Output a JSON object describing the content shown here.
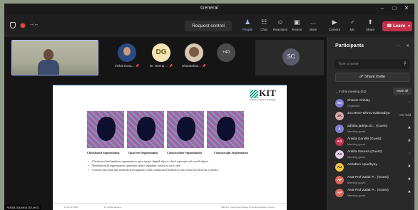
{
  "window": {
    "title": "General"
  },
  "toolbar": {
    "timer": "--:--",
    "request_control": "Request control",
    "items": [
      {
        "label": "People",
        "icon": "people-icon",
        "glyph": "♟"
      },
      {
        "label": "Chat",
        "icon": "chat-icon",
        "glyph": "☷"
      },
      {
        "label": "Reactions",
        "icon": "reactions-icon",
        "glyph": "☺"
      },
      {
        "label": "Rooms",
        "icon": "rooms-icon",
        "glyph": "▣"
      },
      {
        "label": "More",
        "icon": "more-icon",
        "glyph": "…"
      },
      {
        "label": "Camera",
        "icon": "camera-icon",
        "glyph": "▶"
      },
      {
        "label": "Mic",
        "icon": "mic-icon",
        "glyph": "♂"
      },
      {
        "label": "Share",
        "icon": "share-icon",
        "glyph": "⬆"
      }
    ],
    "leave": "Leave"
  },
  "stage": {
    "attendees": [
      {
        "name": "Vishal Nesa..."
      },
      {
        "name": "Dr. Neeraj ...",
        "initials": "DG"
      },
      {
        "name": "Dhanashas..."
      }
    ],
    "more_count": "+40",
    "sc_initials": "SC",
    "self_name": "Ankita Saxena (Guest)"
  },
  "slide": {
    "logo_text": "KIT",
    "logo_sub": "Karlsruhe Institute of Technology",
    "labels": [
      "Checkboard Segmentation",
      "Quad tree Segmentation",
      "Contrast filter Segmentation",
      "Contrast split Segmentation"
    ],
    "bullets": [
      "Chessboard and quadtree segmentation- give square shaped objects- don't represent real world objects",
      "Multithreshold segmentation- generates object segments- based on color only",
      "Contrast filter and split methods are brightness value complicated methods as the results are difficult to predict."
    ],
    "footer_left": "15  21.07.2022",
    "footer_mid": "Dr. Ankita Saxena",
    "footer_right": "IMK-IFU / Land Use Change & Climate Research Group"
  },
  "panel": {
    "title": "Participants",
    "search_placeholder": "Type a name",
    "share_invite": "Share invite",
    "section_label": "In this meeting (53)",
    "mute_all": "Mute all",
    "participants": [
      {
        "initials": "SC",
        "name": "Sharon Christy",
        "role": "Organizer",
        "color": "#7b7fcf",
        "status": "mic"
      },
      {
        "initials": "2K",
        "name": "21CH037-Dhruv Kalavadiya",
        "role": "",
        "color": "#d7a9a9",
        "status": "On hold"
      },
      {
        "initials": "A",
        "name": "adhiba.jadeja.ctt... (Guest)",
        "role": "Meeting guest",
        "color": "#7b7fcf",
        "status": "mic-off"
      },
      {
        "initials": "AG",
        "name": "Ankita Gandhi (Guest)",
        "role": "Meeting guest",
        "color": "#c4314b",
        "status": "mic-off"
      },
      {
        "initials": "AS",
        "name": "Ankita Saxena (Guest)",
        "role": "Meeting guest",
        "color": "#e8cfe8",
        "status": "mic"
      },
      {
        "initials": "AU",
        "name": "Ashaben Upadhyay",
        "role": "",
        "color": "#f4c542",
        "status": "mic-off"
      },
      {
        "initials": "AP",
        "name": "Asst Prof Zalak P... (Guest)",
        "role": "Meeting guest",
        "color": "#d9675a",
        "status": "mic-off"
      },
      {
        "initials": "AP",
        "name": "Asst Prof Zalak P... (Guest)",
        "role": "Meeting guest",
        "color": "#d9675a",
        "status": "mic-off"
      }
    ]
  }
}
